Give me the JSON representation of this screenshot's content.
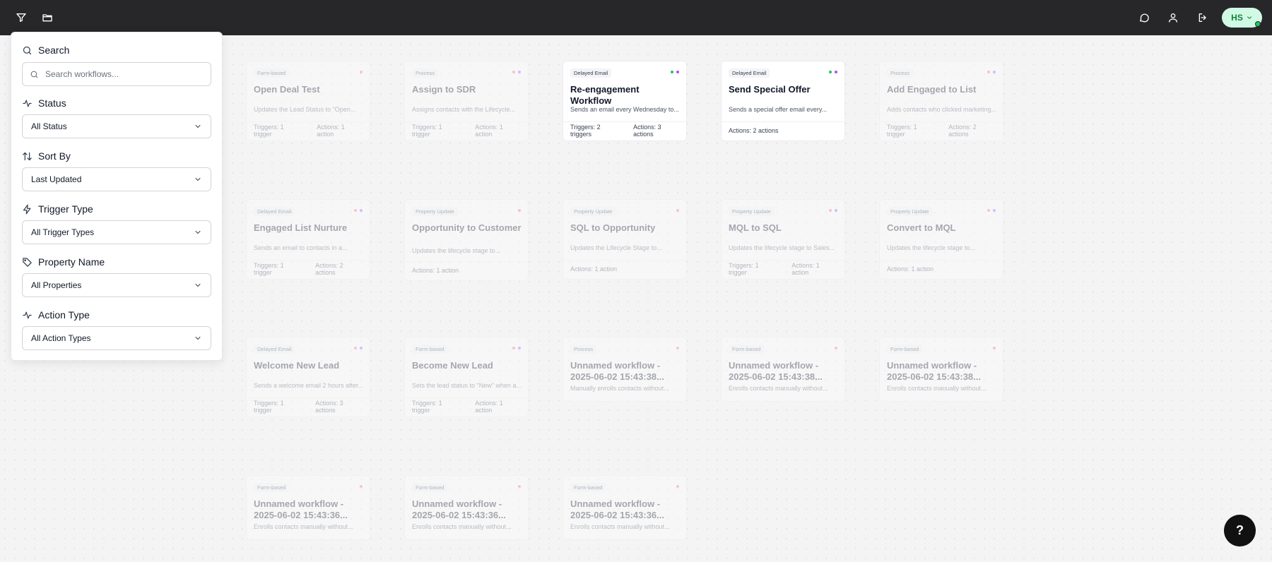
{
  "topbar": {
    "avatar_initials": "HS"
  },
  "filters": {
    "search": {
      "label": "Search",
      "placeholder": "Search workflows..."
    },
    "status": {
      "label": "Status",
      "value": "All Status"
    },
    "sort_by": {
      "label": "Sort By",
      "value": "Last Updated"
    },
    "trigger_type": {
      "label": "Trigger Type",
      "value": "All Trigger Types"
    },
    "property_name": {
      "label": "Property Name",
      "value": "All Properties"
    },
    "action_type": {
      "label": "Action Type",
      "value": "All Action Types"
    }
  },
  "workflows": [
    {
      "type": "Form-based",
      "title": "Open Deal Test",
      "desc": "Updates the Lead Status to \"Open...",
      "triggers": "Triggers: 1 trigger",
      "actions": "Actions: 1 action",
      "dots": [
        "#f87171"
      ]
    },
    {
      "type": "Process",
      "title": "Assign to SDR",
      "desc": "Assigns contacts with the Lifecycle...",
      "triggers": "Triggers: 1 trigger",
      "actions": "Actions: 1 action",
      "dots": [
        "#f87171",
        "#a855f7"
      ]
    },
    {
      "type": "Delayed Email",
      "title": "Re-engagement Workflow",
      "desc": "Sends an email every Wednesday to...",
      "triggers": "Triggers: 2 triggers",
      "actions": "Actions: 3 actions",
      "dots": [
        "#22c55e",
        "#a855f7"
      ]
    },
    {
      "type": "Delayed Email",
      "title": "Send Special Offer",
      "desc": "Sends a special offer email every...",
      "triggers": "",
      "actions": "Actions: 2 actions",
      "dots": [
        "#22c55e",
        "#a855f7"
      ]
    },
    {
      "type": "Process",
      "title": "Add Engaged to List",
      "desc": "Adds contacts who clicked marketing...",
      "triggers": "Triggers: 1 trigger",
      "actions": "Actions: 2 actions",
      "dots": [
        "#f87171",
        "#a855f7"
      ]
    },
    {
      "type": "Delayed Email",
      "title": "Engaged List Nurture",
      "desc": "Sends an email to contacts in a...",
      "triggers": "Triggers: 1 trigger",
      "actions": "Actions: 2 actions",
      "dots": [
        "#f87171",
        "#a855f7"
      ]
    },
    {
      "type": "Property Update",
      "title": "Opportunity to Customer",
      "desc": "Updates the lifecycle stage to...",
      "triggers": "",
      "actions": "Actions: 1 action",
      "dots": [
        "#f87171"
      ]
    },
    {
      "type": "Property Update",
      "title": "SQL to Opportunity",
      "desc": "Updates the Lifecycle Stage to...",
      "triggers": "",
      "actions": "Actions: 1 action",
      "dots": [
        "#f87171"
      ]
    },
    {
      "type": "Property Update",
      "title": "MQL to SQL",
      "desc": "Updates the lifecycle stage to Sales...",
      "triggers": "Triggers: 1 trigger",
      "actions": "Actions: 1 action",
      "dots": [
        "#f87171",
        "#a855f7"
      ]
    },
    {
      "type": "Property Update",
      "title": "Convert to MQL",
      "desc": "Updates the lifecycle stage to...",
      "triggers": "",
      "actions": "Actions: 1 action",
      "dots": [
        "#f87171",
        "#a855f7"
      ]
    },
    {
      "type": "Delayed Email",
      "title": "Welcome New Lead",
      "desc": "Sends a welcome email 2 hours after...",
      "triggers": "Triggers: 1 trigger",
      "actions": "Actions: 3 actions",
      "dots": [
        "#f87171",
        "#a855f7"
      ]
    },
    {
      "type": "Form-based",
      "title": "Become New Lead",
      "desc": "Sets the lead status to \"New\" when a...",
      "triggers": "Triggers: 1 trigger",
      "actions": "Actions: 1 action",
      "dots": [
        "#f87171",
        "#a855f7"
      ]
    },
    {
      "type": "Process",
      "title": "Unnamed workflow - 2025-06-02 15:43:38...",
      "desc": "Manually enrolls contacts without...",
      "triggers": "",
      "actions": "",
      "dots": [
        "#f87171"
      ]
    },
    {
      "type": "Form-based",
      "title": "Unnamed workflow - 2025-06-02 15:43:38...",
      "desc": "Enrolls contacts manually without...",
      "triggers": "",
      "actions": "",
      "dots": [
        "#f87171"
      ]
    },
    {
      "type": "Form-based",
      "title": "Unnamed workflow - 2025-06-02 15:43:38...",
      "desc": "Enrolls contacts manually without...",
      "triggers": "",
      "actions": "",
      "dots": [
        "#f87171"
      ]
    },
    {
      "type": "Form-based",
      "title": "Unnamed workflow - 2025-06-02 15:43:36...",
      "desc": "Enrolls contacts manually without...",
      "triggers": "",
      "actions": "",
      "dots": [
        "#f87171"
      ]
    },
    {
      "type": "Form-based",
      "title": "Unnamed workflow - 2025-06-02 15:43:36...",
      "desc": "Enrolls contacts manually without...",
      "triggers": "",
      "actions": "",
      "dots": [
        "#f87171"
      ]
    },
    {
      "type": "Form-based",
      "title": "Unnamed workflow - 2025-06-02 15:43:36...",
      "desc": "Enrolls contacts manually without...",
      "triggers": "",
      "actions": "",
      "dots": [
        "#f87171"
      ]
    }
  ],
  "help_label": "?"
}
